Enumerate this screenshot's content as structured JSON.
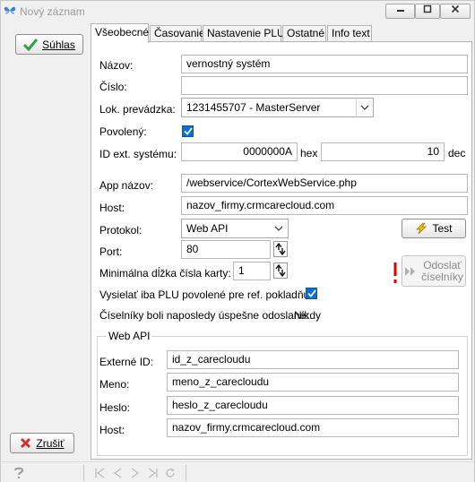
{
  "window": {
    "title": "Nový záznam"
  },
  "actions": {
    "confirm_label": "Súhlas",
    "cancel_label": "Zrušiť"
  },
  "tabs": [
    "Všeobecné",
    "Časovanie",
    "Nastavenie PLU",
    "Ostatné",
    "Info text"
  ],
  "form": {
    "name_label": "Názov:",
    "name_value": "vernostný systém",
    "number_label": "Číslo:",
    "number_value": "",
    "store_label": "Lok. prevádzka:",
    "store_value": "1231455707 - MasterServer",
    "enabled_label": "Povolený:",
    "enabled": true,
    "extid_label": "ID ext. systému:",
    "extid_hex": "0000000A",
    "hex_label": "hex",
    "extid_dec": "10",
    "dec_label": "dec",
    "app_label": "App názov:",
    "app_value": "/webservice/CortexWebService.php",
    "host_label": "Host:",
    "host_value": "nazov_firmy.crmcarecloud.com",
    "protocol_label": "Protokol:",
    "protocol_value": "Web API",
    "test_label": "Test",
    "port_label": "Port:",
    "port_value": "80",
    "minlen_label": "Minimálna dĺžka čísla karty:",
    "minlen_value": "1",
    "send_label_line1": "Odoslať",
    "send_label_line2": "číselníky",
    "sendplu_label": "Vysielať iba PLU povolené pre ref. pokladňu:",
    "sendplu": true,
    "lastsent_label": "Číselníky boli naposledy úspešne odoslané:",
    "lastsent_value": "Nikdy"
  },
  "webapi": {
    "title": "Web API",
    "extid_label": "Externé ID:",
    "extid_value": "id_z_carecloudu",
    "user_label": "Meno:",
    "user_value": "meno_z_carecloudu",
    "pass_label": "Heslo:",
    "pass_value": "heslo_z_carecloudu",
    "host_label": "Host:",
    "host_value": "nazov_firmy.crmcarecloud.com"
  },
  "icons": {
    "app": "butterfly-icon",
    "confirm": "checkmark-icon",
    "cancel": "x-icon",
    "test": "lightning-icon",
    "send": "double-chevron-icon",
    "warning": "exclamation-icon",
    "help": "help-icon"
  },
  "colors": {
    "check_green": "#2ea043",
    "cancel_red": "#d62d2d",
    "checkbox_blue": "#0f6fd0",
    "warning_red": "#e00000"
  }
}
